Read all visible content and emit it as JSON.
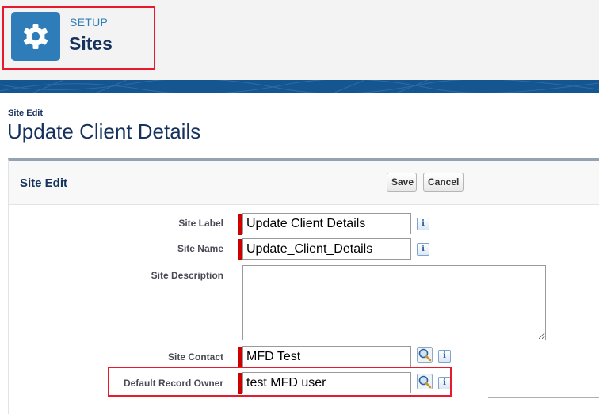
{
  "header": {
    "eyebrow": "SETUP",
    "title": "Sites",
    "icon": "gear-icon",
    "icon_bg": "#2e7db8",
    "highlight_color": "#e8192c"
  },
  "page": {
    "eyebrow": "Site Edit",
    "title": "Update Client Details"
  },
  "panel": {
    "title": "Site Edit",
    "buttons": {
      "save": "Save",
      "cancel": "Cancel"
    }
  },
  "fields": {
    "site_label": {
      "label": "Site Label",
      "value": "Update Client Details",
      "required": true
    },
    "site_name": {
      "label": "Site Name",
      "value": "Update_Client_Details",
      "required": true
    },
    "site_description": {
      "label": "Site Description",
      "value": ""
    },
    "site_contact": {
      "label": "Site Contact",
      "value": "MFD Test",
      "required": true
    },
    "default_record_owner": {
      "label": "Default Record Owner",
      "value": "test MFD user",
      "required": true
    }
  },
  "icons": {
    "info": "i",
    "lookup": "magnifier-icon"
  },
  "colors": {
    "brand_blue": "#155690",
    "required_red": "#cc0000",
    "panel_border": "#96a2b4"
  }
}
